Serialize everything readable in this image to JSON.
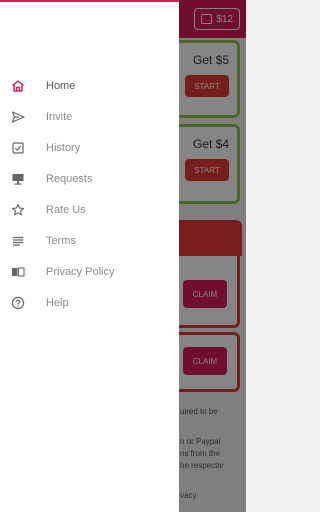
{
  "header": {
    "balance": "$12"
  },
  "offers": [
    {
      "title": "Get $5",
      "button": "START"
    },
    {
      "title": "Get $4",
      "button": "START"
    }
  ],
  "claims": [
    {
      "button": "CLAIM"
    },
    {
      "button": "CLAIM"
    }
  ],
  "background_text": [
    "uired to be",
    "n or Paypal",
    "ns from the",
    "he respectiv",
    "vacy"
  ],
  "drawer": {
    "items": [
      {
        "label": "Home",
        "icon": "home-icon",
        "active": true
      },
      {
        "label": "Invite",
        "icon": "send-icon"
      },
      {
        "label": "History",
        "icon": "checkbox-icon"
      },
      {
        "label": "Requests",
        "icon": "monitor-icon"
      },
      {
        "label": "Rate Us",
        "icon": "star-icon"
      },
      {
        "label": "Terms",
        "icon": "lines-icon"
      },
      {
        "label": "Privacy Policy",
        "icon": "book-icon"
      },
      {
        "label": "Help",
        "icon": "help-icon"
      }
    ]
  },
  "colors": {
    "accent": "#d81b5a",
    "start_button": "#e53935",
    "green_border": "#8bc34a"
  }
}
